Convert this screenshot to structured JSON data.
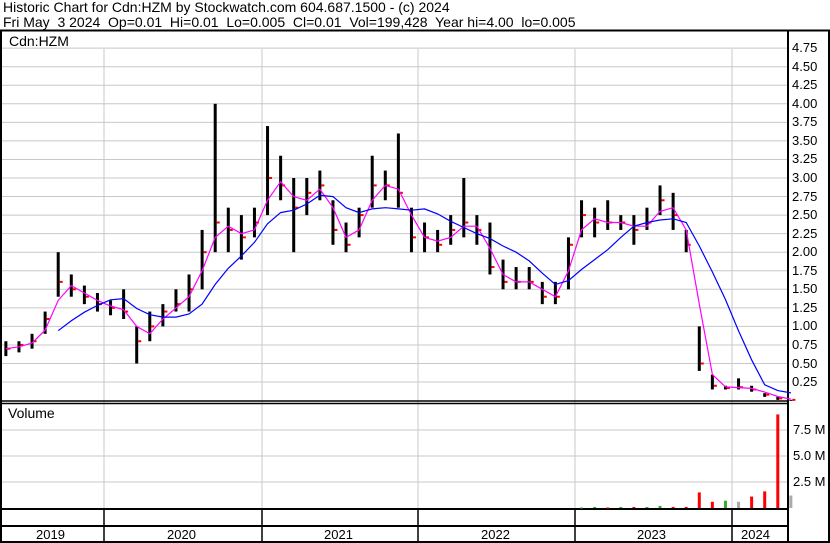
{
  "header": {
    "title": "Historic Chart for Cdn:HZM by Stockwatch.com 604.687.1500 - (c) 2024",
    "quote": "Fri May  3 2024  Op=0.01  Hi=0.01  Lo=0.005  Cl=0.01  Vol=199,428  Year hi=4.00  lo=0.005"
  },
  "chart_data": {
    "type": "line",
    "title": "Historic Chart for Cdn:HZM",
    "symbol_label": "Cdn:HZM",
    "volume_label": "Volume",
    "price_ticks": [
      "0.25",
      "0.50",
      "0.75",
      "1.00",
      "1.25",
      "1.50",
      "1.75",
      "2.00",
      "2.25",
      "2.50",
      "2.75",
      "3.00",
      "3.25",
      "3.50",
      "3.75",
      "4.00",
      "4.25",
      "4.50",
      "4.75"
    ],
    "price_ylim": [
      0,
      4.85
    ],
    "volume_ticks": [
      "2.5 M",
      "5.0 M",
      "7.5 M"
    ],
    "volume_tick_values": [
      2.5,
      5.0,
      7.5
    ],
    "volume_ylim": [
      0,
      10
    ],
    "years": [
      "2019",
      "2020",
      "2021",
      "2022",
      "2023",
      "2024"
    ],
    "colors": {
      "bar": "#000000",
      "close": "#ff0000",
      "ma_short": "#ff00ff",
      "ma_long": "#0000ff",
      "vol_up": "#33aa33",
      "vol_down": "#ff0000",
      "vol_flat": "#aaaaaa",
      "grid": "#c8c8c8"
    },
    "months": [
      "2019-04",
      "2019-05",
      "2019-06",
      "2019-07",
      "2019-08",
      "2019-09",
      "2019-10",
      "2019-11",
      "2019-12",
      "2020-01",
      "2020-02",
      "2020-03",
      "2020-04",
      "2020-05",
      "2020-06",
      "2020-07",
      "2020-08",
      "2020-09",
      "2020-10",
      "2020-11",
      "2020-12",
      "2021-01",
      "2021-02",
      "2021-03",
      "2021-04",
      "2021-05",
      "2021-06",
      "2021-07",
      "2021-08",
      "2021-09",
      "2021-10",
      "2021-11",
      "2021-12",
      "2022-01",
      "2022-02",
      "2022-03",
      "2022-04",
      "2022-05",
      "2022-06",
      "2022-07",
      "2022-08",
      "2022-09",
      "2022-10",
      "2022-11",
      "2022-12",
      "2023-01",
      "2023-02",
      "2023-03",
      "2023-04",
      "2023-05",
      "2023-06",
      "2023-07",
      "2023-08",
      "2023-09",
      "2023-10",
      "2023-11",
      "2023-12",
      "2024-01",
      "2024-02",
      "2024-03",
      "2024-04",
      "2024-05"
    ],
    "high": [
      0.8,
      0.8,
      0.8,
      0.9,
      1.2,
      2.0,
      1.7,
      1.55,
      1.45,
      1.35,
      1.5,
      1.0,
      1.2,
      1.3,
      1.5,
      1.7,
      2.3,
      4.0,
      2.6,
      2.5,
      2.6,
      3.7,
      3.3,
      3.0,
      3.0,
      3.1,
      2.7,
      2.4,
      2.6,
      3.3,
      3.1,
      3.6,
      2.6,
      2.4,
      2.3,
      2.5,
      3.0,
      2.5,
      2.4,
      1.9,
      1.8,
      1.8,
      1.6,
      1.6,
      2.2,
      2.7,
      2.6,
      2.7,
      2.5,
      2.5,
      2.6,
      2.9,
      2.8,
      2.3,
      1.0,
      0.35,
      0.2,
      0.3,
      0.2,
      0.1,
      0.05,
      0.01
    ],
    "low": [
      0.6,
      0.6,
      0.65,
      0.7,
      0.9,
      1.4,
      1.4,
      1.3,
      1.2,
      1.15,
      1.1,
      0.5,
      0.8,
      1.0,
      1.2,
      1.2,
      1.5,
      2.0,
      2.0,
      1.9,
      2.2,
      2.5,
      2.7,
      2.0,
      2.5,
      2.7,
      2.1,
      2.0,
      2.2,
      2.6,
      2.7,
      2.6,
      2.0,
      2.0,
      2.0,
      2.1,
      2.2,
      2.1,
      1.7,
      1.5,
      1.5,
      1.5,
      1.3,
      1.3,
      1.5,
      2.2,
      2.2,
      2.3,
      2.3,
      2.1,
      2.3,
      2.5,
      2.3,
      2.0,
      0.4,
      0.15,
      0.15,
      0.15,
      0.12,
      0.05,
      0.01,
      0.005
    ],
    "close": [
      0.7,
      0.7,
      0.75,
      0.8,
      1.1,
      1.6,
      1.5,
      1.4,
      1.3,
      1.25,
      1.2,
      0.8,
      1.0,
      1.2,
      1.3,
      1.5,
      2.0,
      2.4,
      2.3,
      2.2,
      2.4,
      3.0,
      2.9,
      2.6,
      2.8,
      2.9,
      2.3,
      2.1,
      2.5,
      2.9,
      2.9,
      2.8,
      2.2,
      2.2,
      2.1,
      2.3,
      2.4,
      2.3,
      1.8,
      1.6,
      1.6,
      1.6,
      1.4,
      1.4,
      2.1,
      2.5,
      2.4,
      2.4,
      2.4,
      2.3,
      2.4,
      2.7,
      2.5,
      2.1,
      0.5,
      0.2,
      0.17,
      0.18,
      0.15,
      0.08,
      0.03,
      0.01
    ],
    "volume_millions": [
      0.05,
      0,
      0,
      0,
      0,
      0,
      0,
      0,
      0,
      0,
      0,
      0,
      0,
      0,
      0,
      0,
      0,
      0,
      0,
      0,
      0,
      0,
      0,
      0,
      0,
      0,
      0,
      0,
      0,
      0,
      0,
      0,
      0,
      0,
      0,
      0,
      0,
      0,
      0,
      0,
      0,
      0,
      0,
      0,
      0,
      0.05,
      0.1,
      0.05,
      0.1,
      0.1,
      0.1,
      0.2,
      0.1,
      0.1,
      1.5,
      0.6,
      0.7,
      0.6,
      1.1,
      1.6,
      9.0,
      1.2
    ],
    "volume_dir": [
      "up",
      "flat",
      "flat",
      "flat",
      "flat",
      "flat",
      "flat",
      "flat",
      "flat",
      "flat",
      "flat",
      "flat",
      "flat",
      "flat",
      "flat",
      "flat",
      "flat",
      "flat",
      "flat",
      "flat",
      "flat",
      "flat",
      "flat",
      "flat",
      "flat",
      "flat",
      "flat",
      "flat",
      "flat",
      "flat",
      "flat",
      "flat",
      "flat",
      "flat",
      "flat",
      "flat",
      "flat",
      "flat",
      "flat",
      "flat",
      "flat",
      "flat",
      "flat",
      "flat",
      "flat",
      "up",
      "up",
      "down",
      "up",
      "down",
      "up",
      "up",
      "down",
      "down",
      "down",
      "down",
      "up",
      "flat",
      "down",
      "down",
      "down",
      "flat"
    ]
  }
}
